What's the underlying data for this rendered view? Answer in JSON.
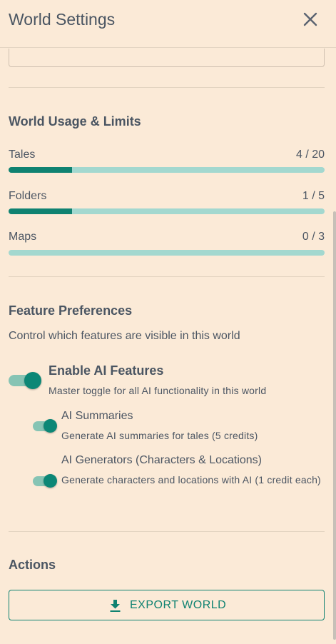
{
  "header": {
    "title": "World Settings",
    "close_icon": "close-icon"
  },
  "usage": {
    "title": "World Usage & Limits",
    "items": [
      {
        "label": "Tales",
        "value": "4 / 20",
        "fraction": 0.2
      },
      {
        "label": "Folders",
        "value": "1 / 5",
        "fraction": 0.2
      },
      {
        "label": "Maps",
        "value": "0 / 3",
        "fraction": 0
      }
    ]
  },
  "features": {
    "title": "Feature Preferences",
    "description": "Control which features are visible in this world",
    "toggles": [
      {
        "title": "Enable AI Features",
        "description": "Master toggle for all AI functionality in this world",
        "enabled": true
      },
      {
        "title": "AI Summaries",
        "description": "Generate AI summaries for tales (5 credits)",
        "enabled": true
      },
      {
        "title": "AI Generators (Characters & Locations)",
        "description": "Generate characters and locations with AI (1 credit each)",
        "enabled": true
      }
    ]
  },
  "actions": {
    "title": "Actions",
    "export_label": "EXPORT WORLD",
    "export_icon": "download-icon"
  },
  "colors": {
    "accent": "#0f8271",
    "track": "#a3d8cf",
    "background": "#fbead7"
  }
}
